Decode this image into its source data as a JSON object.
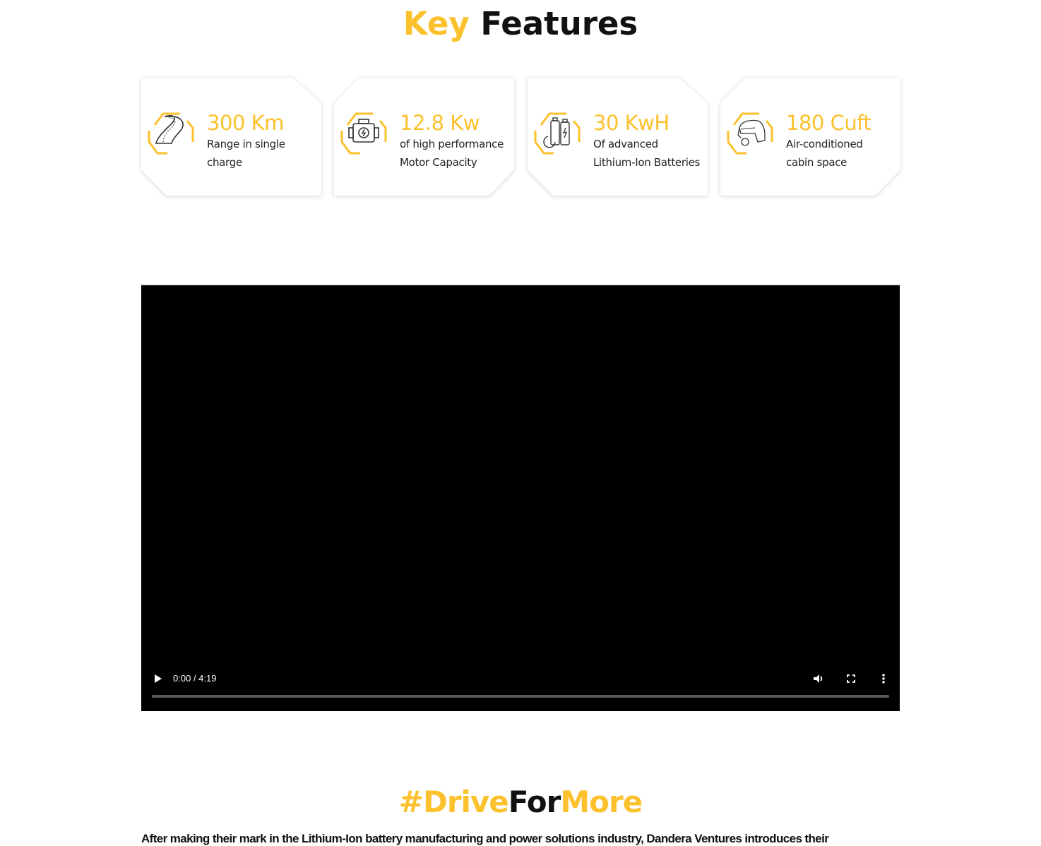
{
  "key_features": {
    "title_highlight": "Key",
    "title_rest": "Features",
    "accent_color": "#fcc12d",
    "cards": [
      {
        "icon": "winding-road-icon",
        "value": "300 Km",
        "desc_line1": "Range in single",
        "desc_line2": "charge"
      },
      {
        "icon": "engine-icon",
        "value": "12.8 Kw",
        "desc_line1": "of high performance",
        "desc_line2": "Motor Capacity"
      },
      {
        "icon": "battery-icon",
        "value": "30 KwH",
        "desc_line1": "Of advanced",
        "desc_line2": "Lithium-Ion Batteries"
      },
      {
        "icon": "auto-rickshaw-icon",
        "value": "180 Cuft",
        "desc_line1": "Air-conditioned",
        "desc_line2": "cabin space"
      }
    ]
  },
  "video": {
    "time_display": "0:00 / 4:19",
    "current_time": "0:00",
    "duration": "4:19",
    "progress_fraction": 0,
    "controls": [
      "play-icon",
      "volume-icon",
      "fullscreen-icon",
      "more-options-icon"
    ]
  },
  "drive_section": {
    "hashtag_part1": "#Drive",
    "hashtag_part2": "For",
    "hashtag_part3": "More",
    "paragraph": "After making their mark in the Lithium-Ion battery manufacturing and power solutions industry, Dandera Ventures introduces their"
  }
}
